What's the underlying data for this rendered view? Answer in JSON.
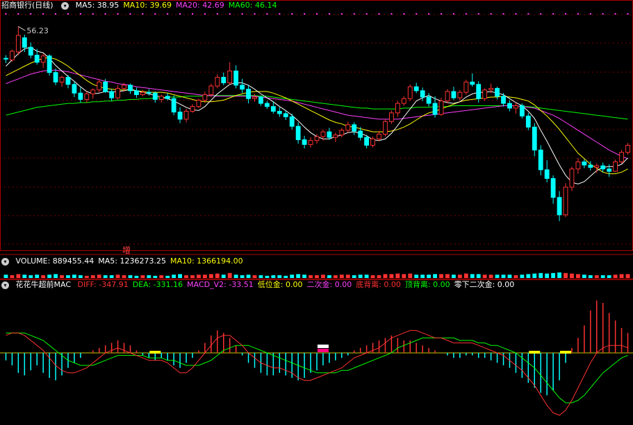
{
  "main": {
    "stock_name": "招商银行(日线)",
    "indicators": [
      {
        "label": "MA5: 38.95",
        "color": "#ffffff"
      },
      {
        "label": "MA10: 39.69",
        "color": "#ffff00"
      },
      {
        "label": "MA20: 42.69",
        "color": "#ff40ff"
      },
      {
        "label": "MA60: 46.14",
        "color": "#00ff00"
      }
    ],
    "high_label": "56.23",
    "marker_text": "增"
  },
  "volume": {
    "indicators": [
      {
        "label": "VOLUME: 889455.44",
        "color": "#ffffff"
      },
      {
        "label": "MA5: 1236273.25",
        "color": "#ffffff"
      },
      {
        "label": "MA10: 1366194.00",
        "color": "#ffff00"
      }
    ]
  },
  "macd": {
    "title": "花花牛超前MAC",
    "indicators": [
      {
        "label": "DIFF: -347.91",
        "color": "#ff3030"
      },
      {
        "label": "DEA: -331.16",
        "color": "#00ff00"
      },
      {
        "label": "MACD_V2: -33.51",
        "color": "#ff40ff"
      },
      {
        "label": "低位金: 0.00",
        "color": "#ffff00"
      },
      {
        "label": "二次金: 0.00",
        "color": "#ff40ff"
      },
      {
        "label": "底背离: 0.00",
        "color": "#ff3030"
      },
      {
        "label": "顶背离: 0.00",
        "color": "#00ff00"
      },
      {
        "label": "零下二次金: 0.00",
        "color": "#ffffff"
      }
    ]
  },
  "chart_data": {
    "type": "candlestick",
    "ylim": [
      28,
      58
    ],
    "candles": [
      [
        52.2,
        52.6,
        51.6,
        52.1
      ],
      [
        52.0,
        53.3,
        51.8,
        53.1
      ],
      [
        53.0,
        56.23,
        52.6,
        55.1
      ],
      [
        54.8,
        55.2,
        53.0,
        53.6
      ],
      [
        53.6,
        54.2,
        52.2,
        52.6
      ],
      [
        52.6,
        53.4,
        51.4,
        51.7
      ],
      [
        51.7,
        52.8,
        51.0,
        52.5
      ],
      [
        52.5,
        52.7,
        50.0,
        50.4
      ],
      [
        50.4,
        50.9,
        48.8,
        49.2
      ],
      [
        49.2,
        50.0,
        48.6,
        49.8
      ],
      [
        49.8,
        50.1,
        48.4,
        48.9
      ],
      [
        48.9,
        49.3,
        47.3,
        47.8
      ],
      [
        47.8,
        48.5,
        46.6,
        47.0
      ],
      [
        47.0,
        48.0,
        46.6,
        47.7
      ],
      [
        47.7,
        48.4,
        47.1,
        48.2
      ],
      [
        48.2,
        49.5,
        47.9,
        49.2
      ],
      [
        49.2,
        49.6,
        47.8,
        48.0
      ],
      [
        48.0,
        48.3,
        46.8,
        47.2
      ],
      [
        47.2,
        48.8,
        47.0,
        48.4
      ],
      [
        48.4,
        49.1,
        48.0,
        48.8
      ],
      [
        48.8,
        49.0,
        47.7,
        48.1
      ],
      [
        48.1,
        48.5,
        47.2,
        47.6
      ],
      [
        47.6,
        48.2,
        47.4,
        47.9
      ],
      [
        47.9,
        48.3,
        47.5,
        47.8
      ],
      [
        47.8,
        48.0,
        46.6,
        47.0
      ],
      [
        47.0,
        47.6,
        46.6,
        47.4
      ],
      [
        47.4,
        47.8,
        46.9,
        47.1
      ],
      [
        47.1,
        47.5,
        45.0,
        45.4
      ],
      [
        45.4,
        46.0,
        44.0,
        44.5
      ],
      [
        44.5,
        45.8,
        44.1,
        45.5
      ],
      [
        45.5,
        46.4,
        45.3,
        46.1
      ],
      [
        46.1,
        47.1,
        45.9,
        46.9
      ],
      [
        46.9,
        48.0,
        46.6,
        47.6
      ],
      [
        47.6,
        49.0,
        47.3,
        48.7
      ],
      [
        48.7,
        50.2,
        48.4,
        49.8
      ],
      [
        49.8,
        50.4,
        48.8,
        49.1
      ],
      [
        49.1,
        51.7,
        48.9,
        50.6
      ],
      [
        50.6,
        51.3,
        48.4,
        48.8
      ],
      [
        48.8,
        49.6,
        47.8,
        48.3
      ],
      [
        48.3,
        48.8,
        46.5,
        47.1
      ],
      [
        47.1,
        47.7,
        46.7,
        47.3
      ],
      [
        47.3,
        47.5,
        46.2,
        46.5
      ],
      [
        46.5,
        46.8,
        45.8,
        46.1
      ],
      [
        46.1,
        46.7,
        45.2,
        45.5
      ],
      [
        45.5,
        46.0,
        44.8,
        45.2
      ],
      [
        45.2,
        45.6,
        44.4,
        44.8
      ],
      [
        44.8,
        45.2,
        43.2,
        43.6
      ],
      [
        43.6,
        44.1,
        41.4,
        41.9
      ],
      [
        41.9,
        42.4,
        40.8,
        41.3
      ],
      [
        41.3,
        42.2,
        40.9,
        41.8
      ],
      [
        41.8,
        42.6,
        41.4,
        42.3
      ],
      [
        42.3,
        43.2,
        41.8,
        42.9
      ],
      [
        42.9,
        43.4,
        41.9,
        42.2
      ],
      [
        42.2,
        42.8,
        41.6,
        42.5
      ],
      [
        42.5,
        43.4,
        42.2,
        43.1
      ],
      [
        43.1,
        44.2,
        42.8,
        43.8
      ],
      [
        43.8,
        44.1,
        42.5,
        43.0
      ],
      [
        43.0,
        43.5,
        41.8,
        42.2
      ],
      [
        42.2,
        42.5,
        40.8,
        41.2
      ],
      [
        41.2,
        42.3,
        40.9,
        42.0
      ],
      [
        42.0,
        43.0,
        41.7,
        42.6
      ],
      [
        42.6,
        44.5,
        42.3,
        44.2
      ],
      [
        44.2,
        45.6,
        43.9,
        45.3
      ],
      [
        45.3,
        46.8,
        44.8,
        46.5
      ],
      [
        46.5,
        47.4,
        46.2,
        47.1
      ],
      [
        47.1,
        48.9,
        46.8,
        48.6
      ],
      [
        48.6,
        49.1,
        47.8,
        48.1
      ],
      [
        48.1,
        48.5,
        46.8,
        47.3
      ],
      [
        47.3,
        47.8,
        46.1,
        46.5
      ],
      [
        46.5,
        47.4,
        44.7,
        45.1
      ],
      [
        45.1,
        47.2,
        44.9,
        46.8
      ],
      [
        46.8,
        48.3,
        46.5,
        48.0
      ],
      [
        48.0,
        48.6,
        46.9,
        47.2
      ],
      [
        47.2,
        48.2,
        46.9,
        47.9
      ],
      [
        47.9,
        49.5,
        47.6,
        49.2
      ],
      [
        49.2,
        50.3,
        48.6,
        48.9
      ],
      [
        48.9,
        49.3,
        46.6,
        47.1
      ],
      [
        47.1,
        48.4,
        46.8,
        48.2
      ],
      [
        48.2,
        49.0,
        47.8,
        48.4
      ],
      [
        48.4,
        48.6,
        47.0,
        47.4
      ],
      [
        47.4,
        47.8,
        46.1,
        46.5
      ],
      [
        46.5,
        46.9,
        45.5,
        45.9
      ],
      [
        45.9,
        46.6,
        45.2,
        46.2
      ],
      [
        46.2,
        46.5,
        44.6,
        44.9
      ],
      [
        44.9,
        45.3,
        43.1,
        43.5
      ],
      [
        43.5,
        44.0,
        39.8,
        40.6
      ],
      [
        40.6,
        41.2,
        37.4,
        38.1
      ],
      [
        38.1,
        39.3,
        36.5,
        37.0
      ],
      [
        37.0,
        37.4,
        33.8,
        34.6
      ],
      [
        34.6,
        35.4,
        31.6,
        32.4
      ],
      [
        32.4,
        36.4,
        32.1,
        35.9
      ],
      [
        35.9,
        38.5,
        35.4,
        38.2
      ],
      [
        38.2,
        39.6,
        37.6,
        39.1
      ],
      [
        39.1,
        39.4,
        38.3,
        38.7
      ],
      [
        38.7,
        39.2,
        38.0,
        38.4
      ],
      [
        38.4,
        38.9,
        37.7,
        38.6
      ],
      [
        38.6,
        39.0,
        37.8,
        38.2
      ],
      [
        38.2,
        38.8,
        37.2,
        37.9
      ],
      [
        37.9,
        39.4,
        37.8,
        39.1
      ],
      [
        39.1,
        40.6,
        38.9,
        40.3
      ],
      [
        40.3,
        41.5,
        40.0,
        41.2
      ]
    ],
    "ma5": [
      51.2,
      52.0,
      52.8,
      53.4,
      53.6,
      53.1,
      52.9,
      52.2,
      51.3,
      50.6,
      49.9,
      49.3,
      48.6,
      48.0,
      47.7,
      47.8,
      48.0,
      47.9,
      48.0,
      48.1,
      48.3,
      48.1,
      47.9,
      47.7,
      47.5,
      47.3,
      47.1,
      46.8,
      46.4,
      46.0,
      45.7,
      45.6,
      46.1,
      46.9,
      47.7,
      48.3,
      48.9,
      49.1,
      49.1,
      48.8,
      48.3,
      47.7,
      47.2,
      46.7,
      46.1,
      45.6,
      45.0,
      44.3,
      43.5,
      42.8,
      42.3,
      42.0,
      42.0,
      42.3,
      42.5,
      42.8,
      42.9,
      42.7,
      42.4,
      41.9,
      41.8,
      42.0,
      42.7,
      43.7,
      44.8,
      45.8,
      46.8,
      47.2,
      47.5,
      47.1,
      46.8,
      46.6,
      46.5,
      46.7,
      47.3,
      47.7,
      47.9,
      47.9,
      48.0,
      47.8,
      47.6,
      47.1,
      46.6,
      46.2,
      45.5,
      44.6,
      43.1,
      41.7,
      40.2,
      38.7,
      37.4,
      36.5,
      36.3,
      36.6,
      37.3,
      38.0,
      38.4,
      38.5,
      38.5,
      38.8,
      39.6
    ],
    "ma10": [
      50.0,
      50.4,
      50.8,
      51.2,
      51.6,
      51.9,
      52.2,
      52.3,
      52.1,
      51.7,
      51.2,
      50.6,
      50.0,
      49.4,
      48.9,
      48.6,
      48.4,
      48.3,
      48.2,
      48.2,
      48.2,
      48.1,
      48.0,
      47.9,
      47.9,
      47.9,
      47.8,
      47.6,
      47.4,
      47.2,
      47.0,
      46.8,
      46.7,
      46.7,
      46.8,
      46.9,
      47.2,
      47.5,
      47.7,
      47.9,
      48.0,
      48.0,
      48.0,
      47.8,
      47.5,
      47.2,
      46.8,
      46.4,
      46.0,
      45.6,
      45.2,
      44.8,
      44.4,
      44.1,
      43.9,
      43.6,
      43.5,
      43.3,
      43.1,
      42.9,
      42.9,
      42.9,
      43.0,
      43.2,
      43.5,
      43.9,
      44.4,
      44.9,
      45.3,
      45.5,
      45.8,
      46.1,
      46.4,
      46.7,
      46.9,
      47.0,
      47.1,
      47.2,
      47.3,
      47.3,
      47.4,
      47.3,
      47.2,
      47.0,
      46.8,
      46.3,
      45.6,
      44.9,
      44.1,
      43.2,
      42.2,
      41.2,
      40.2,
      39.5,
      38.8,
      38.3,
      37.8,
      37.6,
      37.6,
      37.8,
      38.2
    ],
    "ma20": [
      49.0,
      49.3,
      49.6,
      49.9,
      50.2,
      50.4,
      50.6,
      50.7,
      50.7,
      50.6,
      50.5,
      50.3,
      50.1,
      49.9,
      49.7,
      49.5,
      49.3,
      49.2,
      49.0,
      48.9,
      48.8,
      48.6,
      48.5,
      48.4,
      48.3,
      48.2,
      48.1,
      48.0,
      47.9,
      47.8,
      47.7,
      47.6,
      47.5,
      47.5,
      47.4,
      47.4,
      47.4,
      47.4,
      47.4,
      47.4,
      47.4,
      47.3,
      47.2,
      47.1,
      47.0,
      46.9,
      46.8,
      46.6,
      46.4,
      46.2,
      46.0,
      45.8,
      45.6,
      45.4,
      45.2,
      45.0,
      44.9,
      44.8,
      44.7,
      44.6,
      44.5,
      44.5,
      44.5,
      44.5,
      44.6,
      44.7,
      44.8,
      44.9,
      45.0,
      45.1,
      45.2,
      45.3,
      45.4,
      45.5,
      45.6,
      45.7,
      45.8,
      45.9,
      46.0,
      46.1,
      46.2,
      46.2,
      46.2,
      46.1,
      46.0,
      45.9,
      45.6,
      45.3,
      45.0,
      44.6,
      44.1,
      43.6,
      43.1,
      42.6,
      42.1,
      41.6,
      41.1,
      40.6,
      40.2,
      39.8,
      39.5
    ],
    "ma60": [
      45.0,
      45.2,
      45.4,
      45.6,
      45.8,
      46.0,
      46.1,
      46.2,
      46.3,
      46.4,
      46.5,
      46.5,
      46.6,
      46.6,
      46.7,
      46.7,
      46.8,
      46.8,
      46.9,
      46.9,
      47.0,
      47.0,
      47.1,
      47.1,
      47.2,
      47.2,
      47.3,
      47.3,
      47.3,
      47.4,
      47.4,
      47.4,
      47.4,
      47.5,
      47.5,
      47.5,
      47.5,
      47.5,
      47.5,
      47.5,
      47.5,
      47.4,
      47.4,
      47.3,
      47.2,
      47.1,
      47.0,
      46.9,
      46.8,
      46.7,
      46.6,
      46.5,
      46.4,
      46.3,
      46.2,
      46.1,
      46.0,
      45.9,
      45.9,
      45.8,
      45.8,
      45.8,
      45.8,
      45.8,
      45.9,
      45.9,
      46.0,
      46.0,
      46.0,
      46.1,
      46.1,
      46.1,
      46.2,
      46.2,
      46.2,
      46.2,
      46.2,
      46.2,
      46.2,
      46.2,
      46.2,
      46.2,
      46.2,
      46.1,
      46.1,
      46.0,
      45.9,
      45.8,
      45.7,
      45.6,
      45.5,
      45.4,
      45.3,
      45.2,
      45.1,
      45.0,
      44.9,
      44.8,
      44.7,
      44.6,
      44.5
    ],
    "volume": [
      0.6,
      0.5,
      0.7,
      0.6,
      0.5,
      0.6,
      0.5,
      0.6,
      0.7,
      0.5,
      0.5,
      0.6,
      0.5,
      0.4,
      0.5,
      0.6,
      0.5,
      0.5,
      0.6,
      0.5,
      0.5,
      0.4,
      0.5,
      0.5,
      0.4,
      0.5,
      0.4,
      0.6,
      0.7,
      0.5,
      0.5,
      0.6,
      0.6,
      0.7,
      0.8,
      0.6,
      0.9,
      0.6,
      0.5,
      0.6,
      0.5,
      0.5,
      0.4,
      0.5,
      0.5,
      0.4,
      0.6,
      0.7,
      0.6,
      0.5,
      0.5,
      0.6,
      0.5,
      0.5,
      0.6,
      0.6,
      0.5,
      0.6,
      0.6,
      0.5,
      0.5,
      0.7,
      0.7,
      0.8,
      0.7,
      0.8,
      0.6,
      0.6,
      0.6,
      0.7,
      0.7,
      0.7,
      0.6,
      0.6,
      0.8,
      0.7,
      0.7,
      0.6,
      0.6,
      0.6,
      0.6,
      0.6,
      0.5,
      0.6,
      0.7,
      0.8,
      0.9,
      0.8,
      0.9,
      1.0,
      0.9,
      0.8,
      0.7,
      0.6,
      0.5,
      0.5,
      0.5,
      0.5,
      0.6,
      0.7,
      0.7
    ],
    "macd_hist": [
      -0.3,
      -0.5,
      -0.8,
      -0.9,
      -0.7,
      -0.5,
      -0.8,
      -1.0,
      -1.1,
      -0.9,
      -0.6,
      -0.4,
      -0.2,
      0.0,
      0.1,
      0.2,
      0.3,
      0.4,
      0.5,
      0.4,
      0.3,
      0.1,
      -0.1,
      -0.2,
      -0.3,
      -0.2,
      -0.3,
      -0.5,
      -0.6,
      -0.4,
      -0.2,
      0.1,
      0.4,
      0.7,
      0.9,
      0.8,
      0.6,
      0.3,
      -0.1,
      -0.4,
      -0.6,
      -0.8,
      -0.9,
      -0.9,
      -0.8,
      -0.9,
      -1.0,
      -1.1,
      -1.0,
      -0.8,
      -0.7,
      -0.5,
      -0.4,
      -0.3,
      -0.2,
      -0.1,
      0.1,
      0.2,
      0.3,
      0.4,
      0.5,
      0.6,
      0.7,
      0.6,
      0.5,
      0.5,
      0.4,
      0.3,
      0.2,
      0.1,
      0.0,
      -0.1,
      -0.2,
      -0.2,
      -0.1,
      -0.1,
      -0.2,
      -0.2,
      -0.3,
      -0.4,
      -0.5,
      -0.6,
      -0.8,
      -1.0,
      -1.2,
      -1.4,
      -1.6,
      -1.7,
      -1.5,
      -1.1,
      -0.4,
      0.2,
      0.6,
      1.1,
      1.7,
      2.1,
      2.0,
      1.6,
      1.3,
      1.0,
      0.8
    ],
    "diff": [
      0.7,
      0.8,
      0.8,
      0.7,
      0.5,
      0.3,
      0.1,
      -0.2,
      -0.5,
      -0.7,
      -0.8,
      -0.8,
      -0.7,
      -0.6,
      -0.4,
      -0.2,
      0.0,
      0.1,
      0.2,
      0.1,
      0.0,
      -0.1,
      -0.2,
      -0.3,
      -0.3,
      -0.3,
      -0.4,
      -0.6,
      -0.8,
      -0.8,
      -0.6,
      -0.3,
      0.0,
      0.3,
      0.6,
      0.7,
      0.7,
      0.5,
      0.3,
      0.0,
      -0.2,
      -0.4,
      -0.5,
      -0.6,
      -0.6,
      -0.7,
      -0.8,
      -1.0,
      -1.1,
      -1.1,
      -1.0,
      -0.9,
      -0.8,
      -0.7,
      -0.6,
      -0.4,
      -0.2,
      -0.1,
      0.0,
      0.1,
      0.2,
      0.4,
      0.6,
      0.7,
      0.8,
      0.9,
      0.9,
      0.8,
      0.7,
      0.6,
      0.6,
      0.5,
      0.4,
      0.4,
      0.4,
      0.4,
      0.3,
      0.2,
      0.1,
      0.0,
      -0.1,
      -0.3,
      -0.5,
      -0.7,
      -1.0,
      -1.3,
      -1.7,
      -2.1,
      -2.4,
      -2.5,
      -2.3,
      -1.9,
      -1.4,
      -0.9,
      -0.4,
      0.0,
      0.2,
      0.3,
      0.3,
      0.3,
      0.2
    ],
    "dea": [
      0.8,
      0.8,
      0.8,
      0.8,
      0.7,
      0.6,
      0.5,
      0.3,
      0.1,
      -0.1,
      -0.3,
      -0.4,
      -0.5,
      -0.5,
      -0.5,
      -0.4,
      -0.3,
      -0.2,
      -0.1,
      -0.1,
      -0.1,
      -0.1,
      -0.1,
      -0.2,
      -0.2,
      -0.2,
      -0.3,
      -0.3,
      -0.4,
      -0.5,
      -0.5,
      -0.5,
      -0.4,
      -0.3,
      -0.1,
      0.1,
      0.2,
      0.3,
      0.3,
      0.3,
      0.2,
      0.1,
      0.0,
      -0.1,
      -0.2,
      -0.3,
      -0.4,
      -0.5,
      -0.6,
      -0.7,
      -0.8,
      -0.8,
      -0.8,
      -0.8,
      -0.7,
      -0.7,
      -0.6,
      -0.5,
      -0.4,
      -0.3,
      -0.2,
      -0.1,
      0.0,
      0.2,
      0.3,
      0.4,
      0.5,
      0.6,
      0.6,
      0.6,
      0.6,
      0.6,
      0.6,
      0.5,
      0.5,
      0.5,
      0.4,
      0.4,
      0.3,
      0.3,
      0.2,
      0.1,
      0.0,
      -0.2,
      -0.4,
      -0.6,
      -0.9,
      -1.2,
      -1.5,
      -1.8,
      -2.0,
      -2.0,
      -1.9,
      -1.7,
      -1.4,
      -1.1,
      -0.8,
      -0.6,
      -0.4,
      -0.2,
      -0.1
    ],
    "signals": [
      {
        "index": 25,
        "color": "#ffff00"
      },
      {
        "index": 51,
        "color": "#ff0080"
      },
      {
        "index": 87,
        "color": "#ffff00"
      },
      {
        "index": 161,
        "color": "#ffff00"
      }
    ]
  }
}
